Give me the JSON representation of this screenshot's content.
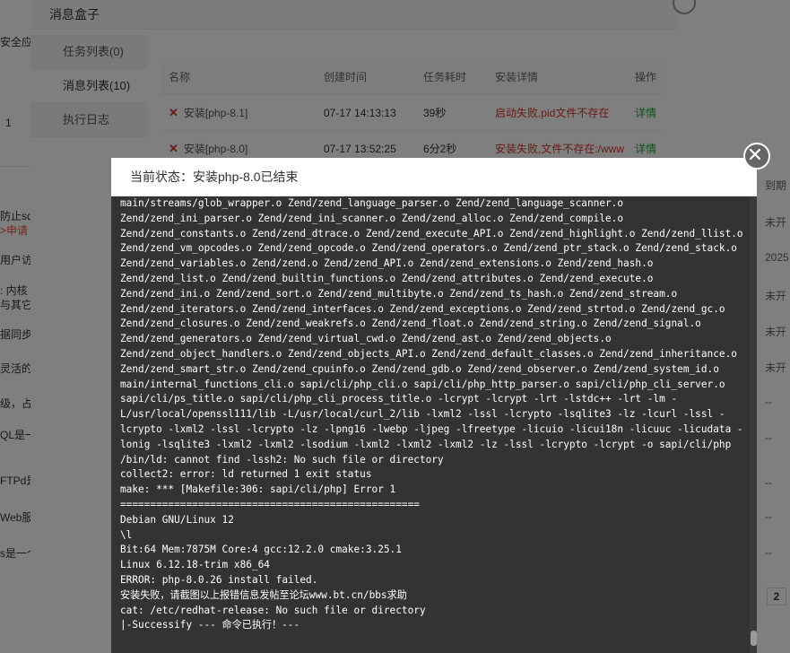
{
  "background": {
    "left_texts": [
      "安全应",
      "1",
      "防止sq",
      ">申请",
      "用户访",
      ": 内核",
      "与其它",
      "据同步",
      "灵活的",
      "级，占",
      "QL是一",
      "FTPd是",
      "Web服",
      "s是一个高性能的key-va"
    ],
    "right_texts": [
      "到期",
      "未开",
      "2025",
      "未开",
      "未开",
      "未开",
      "--",
      "--",
      "--",
      "--",
      "--"
    ],
    "pager_current": "2"
  },
  "message_box": {
    "title": "消息盒子",
    "menu": [
      {
        "label": "任务列表(0)"
      },
      {
        "label": "消息列表(10)"
      },
      {
        "label": "执行日志"
      }
    ],
    "table": {
      "headers": [
        "名称",
        "创建时间",
        "任务耗时",
        "安装详情",
        "操作"
      ],
      "rows": [
        {
          "name": "安装[php-8.1]",
          "created": "07-17 14:13:13",
          "duration": "39秒",
          "status": "启动失败,pid文件不存在",
          "action": "详情"
        },
        {
          "name": "安装[php-8.0]",
          "created": "07-17 13:52:25",
          "duration": "6分2秒",
          "status": "安装失败,文件不存在:/www",
          "action": "详情"
        }
      ]
    }
  },
  "log_dialog": {
    "status": "当前状态：安装php-8.0已结束",
    "lines": [
      "main/streams/glob_wrapper.o Zend/zend_language_parser.o Zend/zend_language_scanner.o",
      "Zend/zend_ini_parser.o Zend/zend_ini_scanner.o Zend/zend_alloc.o Zend/zend_compile.o",
      "Zend/zend_constants.o Zend/zend_dtrace.o Zend/zend_execute_API.o Zend/zend_highlight.o Zend/zend_llist.o",
      "Zend/zend_vm_opcodes.o Zend/zend_opcode.o Zend/zend_operators.o Zend/zend_ptr_stack.o Zend/zend_stack.o",
      "Zend/zend_variables.o Zend/zend.o Zend/zend_API.o Zend/zend_extensions.o Zend/zend_hash.o",
      "Zend/zend_list.o Zend/zend_builtin_functions.o Zend/zend_attributes.o Zend/zend_execute.o",
      "Zend/zend_ini.o Zend/zend_sort.o Zend/zend_multibyte.o Zend/zend_ts_hash.o Zend/zend_stream.o",
      "Zend/zend_iterators.o Zend/zend_interfaces.o Zend/zend_exceptions.o Zend/zend_strtod.o Zend/zend_gc.o",
      "Zend/zend_closures.o Zend/zend_weakrefs.o Zend/zend_float.o Zend/zend_string.o Zend/zend_signal.o",
      "Zend/zend_generators.o Zend/zend_virtual_cwd.o Zend/zend_ast.o Zend/zend_objects.o",
      "Zend/zend_object_handlers.o Zend/zend_objects_API.o Zend/zend_default_classes.o Zend/zend_inheritance.o",
      "Zend/zend_smart_str.o Zend/zend_cpuinfo.o Zend/zend_gdb.o Zend/zend_observer.o Zend/zend_system_id.o",
      "main/internal_functions_cli.o sapi/cli/php_cli.o sapi/cli/php_http_parser.o sapi/cli/php_cli_server.o",
      "sapi/cli/ps_title.o sapi/cli/php_cli_process_title.o -lcrypt -lcrypt -lrt -lstdc++ -lrt -lm -",
      "L/usr/local/openssl111/lib -L/usr/local/curl_2/lib -lxml2 -lssl -lcrypto -lsqlite3 -lz -lcurl -lssl -",
      "lcrypto -lxml2 -lssl -lcrypto -lz -lpng16 -lwebp -ljpeg -lfreetype -licuio -licui18n -licuuc -licudata -",
      "lonig -lsqlite3 -lxml2 -lxml2 -lsodium -lxml2 -lxml2 -lxml2 -lz -lssl -lcrypto -lcrypt -o sapi/cli/php",
      "/bin/ld: cannot find -lssh2: No such file or directory",
      "collect2: error: ld returned 1 exit status",
      "make: *** [Makefile:306: sapi/cli/php] Error 1",
      "==================================================",
      "Debian GNU/Linux 12",
      "\\l",
      "Bit:64 Mem:7875M Core:4 gcc:12.2.0 cmake:3.25.1",
      "Linux 6.12.18-trim x86_64",
      "ERROR: php-8.0.26 install failed.",
      "安装失败，请截图以上报错信息发帖至论坛www.bt.cn/bbs求助",
      "cat: /etc/redhat-release: No such file or directory",
      "|-Successify --- 命令已执行！---"
    ]
  }
}
